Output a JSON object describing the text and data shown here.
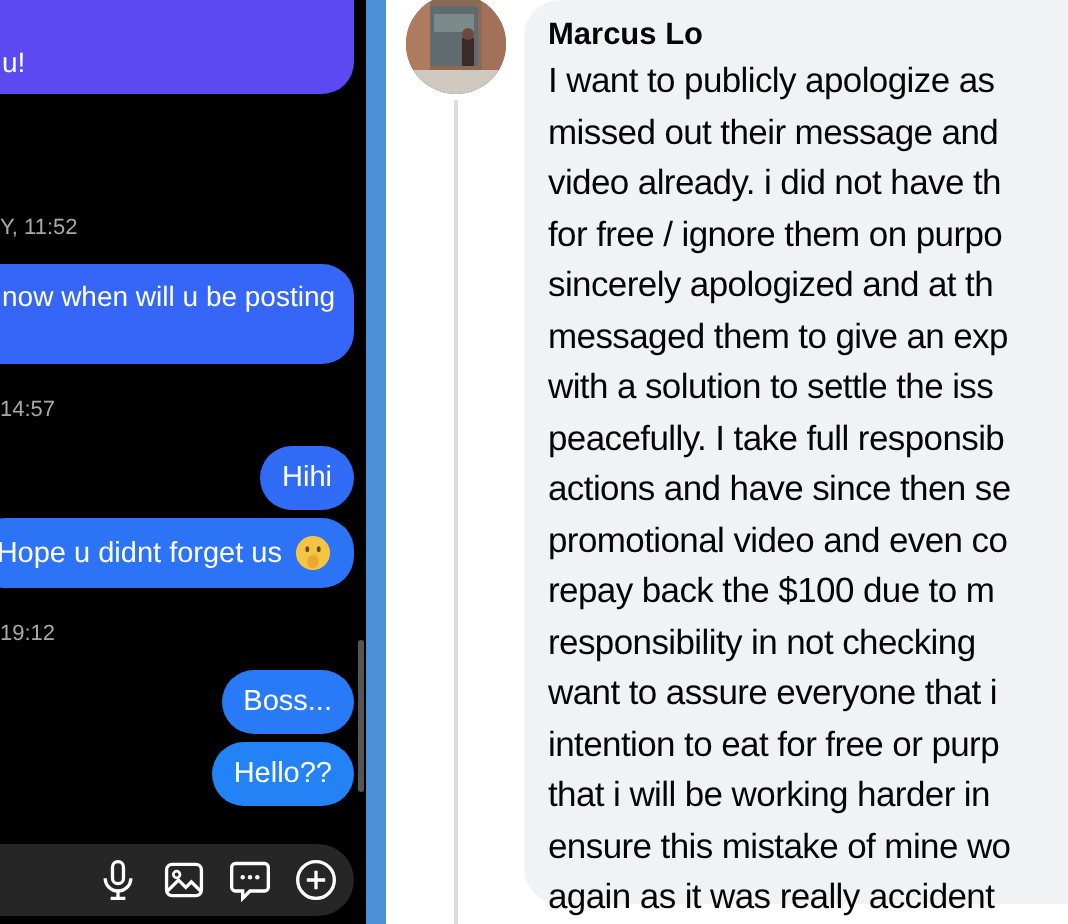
{
  "chat": {
    "messages": [
      {
        "kind": "bubble",
        "text": "u!"
      },
      {
        "kind": "timestamp",
        "text": "Y, 11:52"
      },
      {
        "kind": "bubble",
        "text": "now when will u be posting"
      },
      {
        "kind": "timestamp",
        "text": "14:57"
      },
      {
        "kind": "bubble",
        "text": "Hihi"
      },
      {
        "kind": "bubble",
        "text": "Hope u didnt forget us",
        "emoji": true
      },
      {
        "kind": "timestamp",
        "text": "19:12"
      },
      {
        "kind": "bubble",
        "text": "Boss..."
      },
      {
        "kind": "bubble",
        "text": "Hello??"
      }
    ]
  },
  "comment": {
    "author": "Marcus Lo",
    "lines": [
      "I want to publicly apologize as",
      "missed out their message and",
      "video already. i did not have th",
      "for free / ignore them on purpo",
      "sincerely apologized and at th",
      "messaged them to give an exp",
      "with a solution to settle the iss",
      "peacefully. I take full responsib",
      "actions and have since then se",
      "promotional video and even co",
      "repay back the $100 due to m",
      "responsibility in not checking",
      "want to assure everyone that i",
      "intention to eat for free or purp",
      "that i will be working harder in",
      "ensure this mistake of mine wo",
      "again as it was really accident"
    ]
  }
}
